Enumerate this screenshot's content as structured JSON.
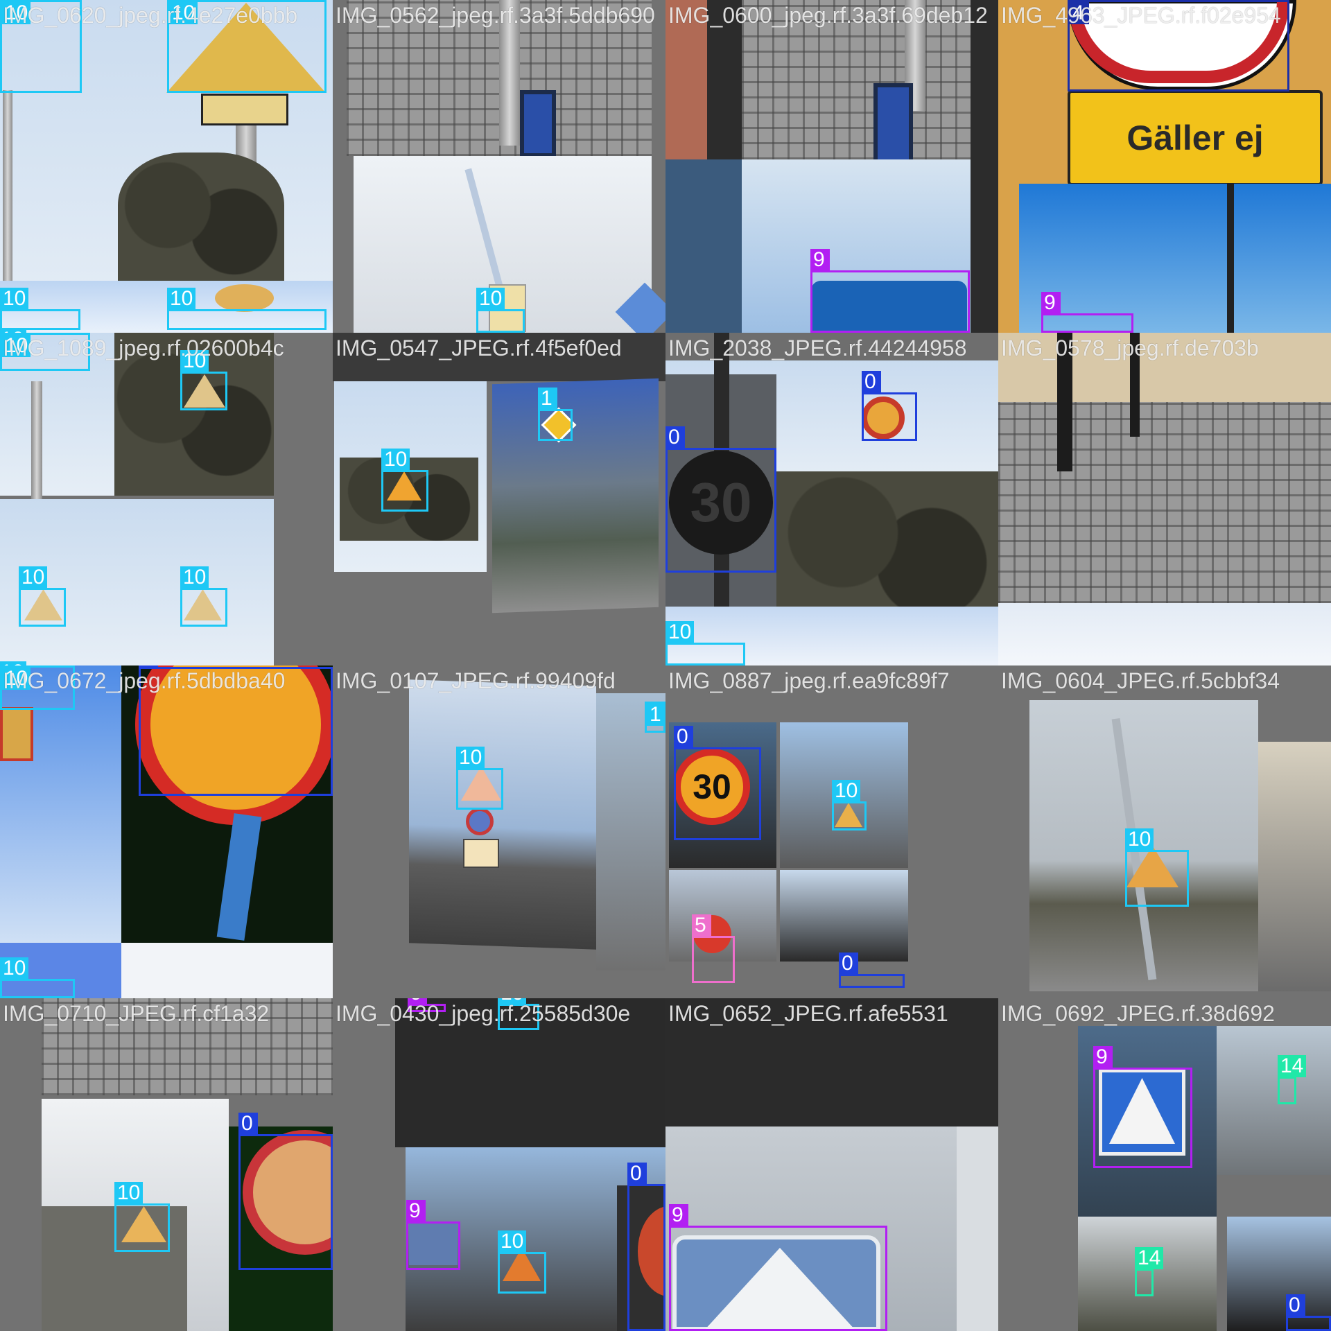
{
  "mosaic": {
    "tiles": [
      {
        "title": "IMG_0620_jpeg.rf.4e27e0bbb",
        "annotations": [
          {
            "label": "10",
            "color": "#1ec8f5"
          },
          {
            "label": "10",
            "color": "#1ec8f5"
          },
          {
            "label": "10",
            "color": "#1ec8f5"
          },
          {
            "label": "10",
            "color": "#1ec8f5"
          },
          {
            "label": "10",
            "color": "#1ec8f5"
          }
        ]
      },
      {
        "title": "IMG_0562_jpeg.rf.3a3f.5ddb690",
        "annotations": [
          {
            "label": "10",
            "color": "#1ec8f5"
          }
        ]
      },
      {
        "title": "IMG_0600_jpeg.rf.3a3f.69deb12",
        "annotations": [
          {
            "label": "9",
            "color": "#b21ff2"
          }
        ]
      },
      {
        "title": "IMG_4963_JPEG.rf.f02e954",
        "annotations": [
          {
            "label": "4",
            "color": "#1b2fa8"
          },
          {
            "label": "9",
            "color": "#b21ff2"
          }
        ]
      },
      {
        "title": "IMG_1089_jpeg.rf.02600b4c",
        "annotations": [
          {
            "label": "10",
            "color": "#1ec8f5"
          },
          {
            "label": "10",
            "color": "#1ec8f5"
          },
          {
            "label": "10",
            "color": "#1ec8f5"
          },
          {
            "label": "10",
            "color": "#1ec8f5"
          },
          {
            "label": "10",
            "color": "#1ec8f5"
          }
        ]
      },
      {
        "title": "IMG_0547_JPEG.rf.4f5ef0ed",
        "annotations": [
          {
            "label": "1",
            "color": "#1ec8f5"
          },
          {
            "label": "10",
            "color": "#1ec8f5"
          }
        ]
      },
      {
        "title": "IMG_2038_JPEG.rf.44244958",
        "annotations": [
          {
            "label": "0",
            "color": "#1f3fdc"
          },
          {
            "label": "0",
            "color": "#1f3fdc"
          },
          {
            "label": "10",
            "color": "#1ec8f5"
          }
        ]
      },
      {
        "title": "IMG_0578_jpeg.rf.de703b",
        "annotations": []
      },
      {
        "title": "IMG_0672_jpeg.rf.5dbdba40",
        "annotations": [
          {
            "label": "10",
            "color": "#1ec8f5"
          },
          {
            "label": "0",
            "color": "#1f3fdc"
          },
          {
            "label": "10",
            "color": "#1ec8f5"
          }
        ]
      },
      {
        "title": "IMG_0107_JPEG.rf.99409fd",
        "annotations": [
          {
            "label": "10",
            "color": "#1ec8f5"
          },
          {
            "label": "1",
            "color": "#1ec8f5"
          }
        ]
      },
      {
        "title": "IMG_0887_jpeg.rf.ea9fc89f7",
        "annotations": [
          {
            "label": "0",
            "color": "#1f3fdc"
          },
          {
            "label": "10",
            "color": "#1ec8f5"
          },
          {
            "label": "5",
            "color": "#ee6fcc"
          },
          {
            "label": "0",
            "color": "#1f3fdc"
          }
        ]
      },
      {
        "title": "IMG_0604_JPEG.rf.5cbbf34",
        "annotations": [
          {
            "label": "10",
            "color": "#1ec8f5"
          }
        ]
      },
      {
        "title": "IMG_0710_JPEG.rf.cf1a32",
        "annotations": [
          {
            "label": "10",
            "color": "#1ec8f5"
          },
          {
            "label": "0",
            "color": "#1f3fdc"
          }
        ]
      },
      {
        "title": "IMG_0430_jpeg.rf.25585d30e",
        "annotations": [
          {
            "label": "9",
            "color": "#b21ff2"
          },
          {
            "label": "10",
            "color": "#1ec8f5"
          },
          {
            "label": "9",
            "color": "#b21ff2"
          },
          {
            "label": "10",
            "color": "#1ec8f5"
          },
          {
            "label": "0",
            "color": "#1f3fdc"
          }
        ]
      },
      {
        "title": "IMG_0652_JPEG.rf.afe5531",
        "annotations": [
          {
            "label": "9",
            "color": "#b21ff2"
          }
        ]
      },
      {
        "title": "IMG_0692_JPEG.rf.38d692",
        "annotations": [
          {
            "label": "9",
            "color": "#b21ff2"
          },
          {
            "label": "14",
            "color": "#20e8a8"
          },
          {
            "label": "14",
            "color": "#20e8a8"
          },
          {
            "label": "0",
            "color": "#1f3fdc"
          }
        ]
      }
    ]
  }
}
